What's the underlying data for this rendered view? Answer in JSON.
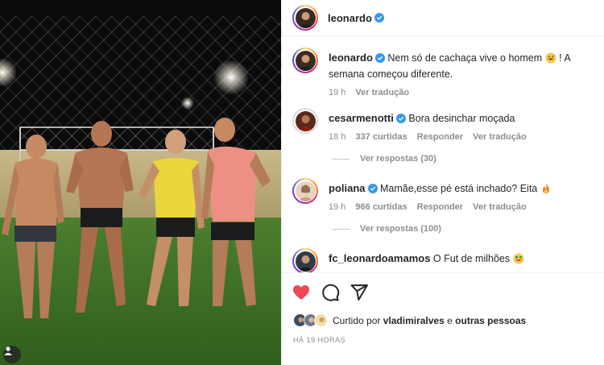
{
  "post": {
    "author": "leonardo",
    "verified": true
  },
  "caption": {
    "author": "leonardo",
    "text_before_emoji": "Nem só de cachaça vive o homem",
    "emoji": "grinning-sweat-emoji",
    "text_after_emoji": "! A semana começou diferente.",
    "time": "19 h",
    "translate": "Ver tradução"
  },
  "comments": [
    {
      "author": "cesarmenotti",
      "verified": true,
      "text": "Bora desinchar moçada",
      "time": "18 h",
      "likes": "337 curtidas",
      "reply": "Responder",
      "translate": "Ver tradução",
      "view_replies": "Ver respostas (30)"
    },
    {
      "author": "poliana",
      "verified": true,
      "text": "Mamãe,esse pé está inchado? Eita",
      "emoji": "fire-emoji",
      "time": "19 h",
      "likes": "966 curtidas",
      "reply": "Responder",
      "translate": "Ver tradução",
      "view_replies": "Ver respostas (100)"
    },
    {
      "author": "fc_leonardoamamos",
      "verified": false,
      "text": "O Fut de milhões",
      "emoji": "money-face-emoji"
    }
  ],
  "actions": {
    "like_icon": "heart-filled-icon",
    "comment_icon": "comment-icon",
    "share_icon": "share-icon",
    "like_color": "#ed4956"
  },
  "liked_by": {
    "prefix": "Curtido por",
    "user": "vladimiralves",
    "conjunction": "e",
    "others": "outras pessoas"
  },
  "timestamp": "HÁ 19 HORAS",
  "colors": {
    "verified_blue": "#3897f0",
    "muted_text": "#8e8e8e"
  }
}
